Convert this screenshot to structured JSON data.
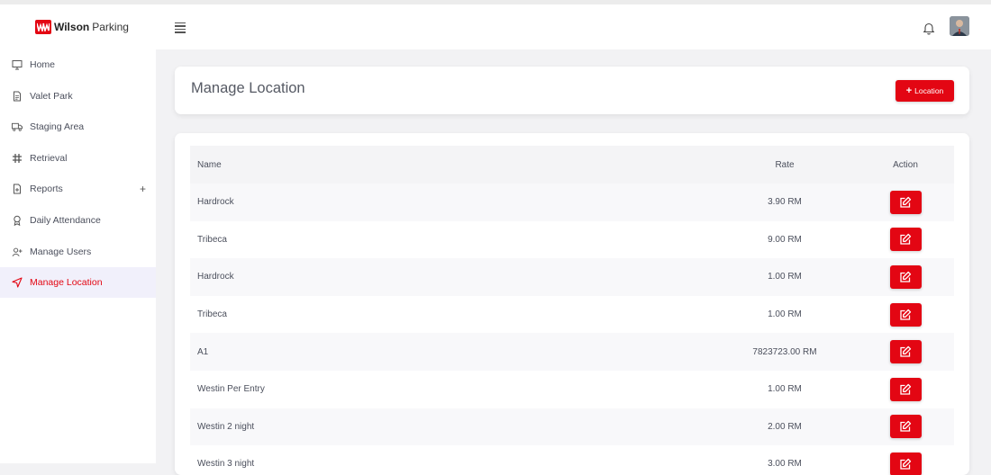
{
  "brand": {
    "name": "Wilson",
    "sub": "Parking",
    "color": "#e30613"
  },
  "sidebar": {
    "items": [
      {
        "label": "Home",
        "icon": "monitor-icon"
      },
      {
        "label": "Valet Park",
        "icon": "document-icon"
      },
      {
        "label": "Staging Area",
        "icon": "truck-icon"
      },
      {
        "label": "Retrieval",
        "icon": "hash-icon"
      },
      {
        "label": "Reports",
        "icon": "report-icon",
        "expandable": true
      },
      {
        "label": "Daily Attendance",
        "icon": "award-icon"
      },
      {
        "label": "Manage Users",
        "icon": "user-plus-icon"
      },
      {
        "label": "Manage Location",
        "icon": "navigation-icon",
        "active": true
      }
    ]
  },
  "header": {
    "title": "Manage Location",
    "add_label": "Location"
  },
  "table": {
    "columns": {
      "name": "Name",
      "rate": "Rate",
      "action": "Action"
    },
    "rows": [
      {
        "name": "Hardrock",
        "rate": "3.90 RM"
      },
      {
        "name": "Tribeca",
        "rate": "9.00 RM"
      },
      {
        "name": "Hardrock",
        "rate": "1.00 RM"
      },
      {
        "name": "Tribeca",
        "rate": "1.00 RM"
      },
      {
        "name": "A1",
        "rate": "7823723.00 RM"
      },
      {
        "name": "Westin Per Entry",
        "rate": "1.00 RM"
      },
      {
        "name": "Westin 2 night",
        "rate": "2.00 RM"
      },
      {
        "name": "Westin 3 night",
        "rate": "3.00 RM"
      }
    ]
  }
}
